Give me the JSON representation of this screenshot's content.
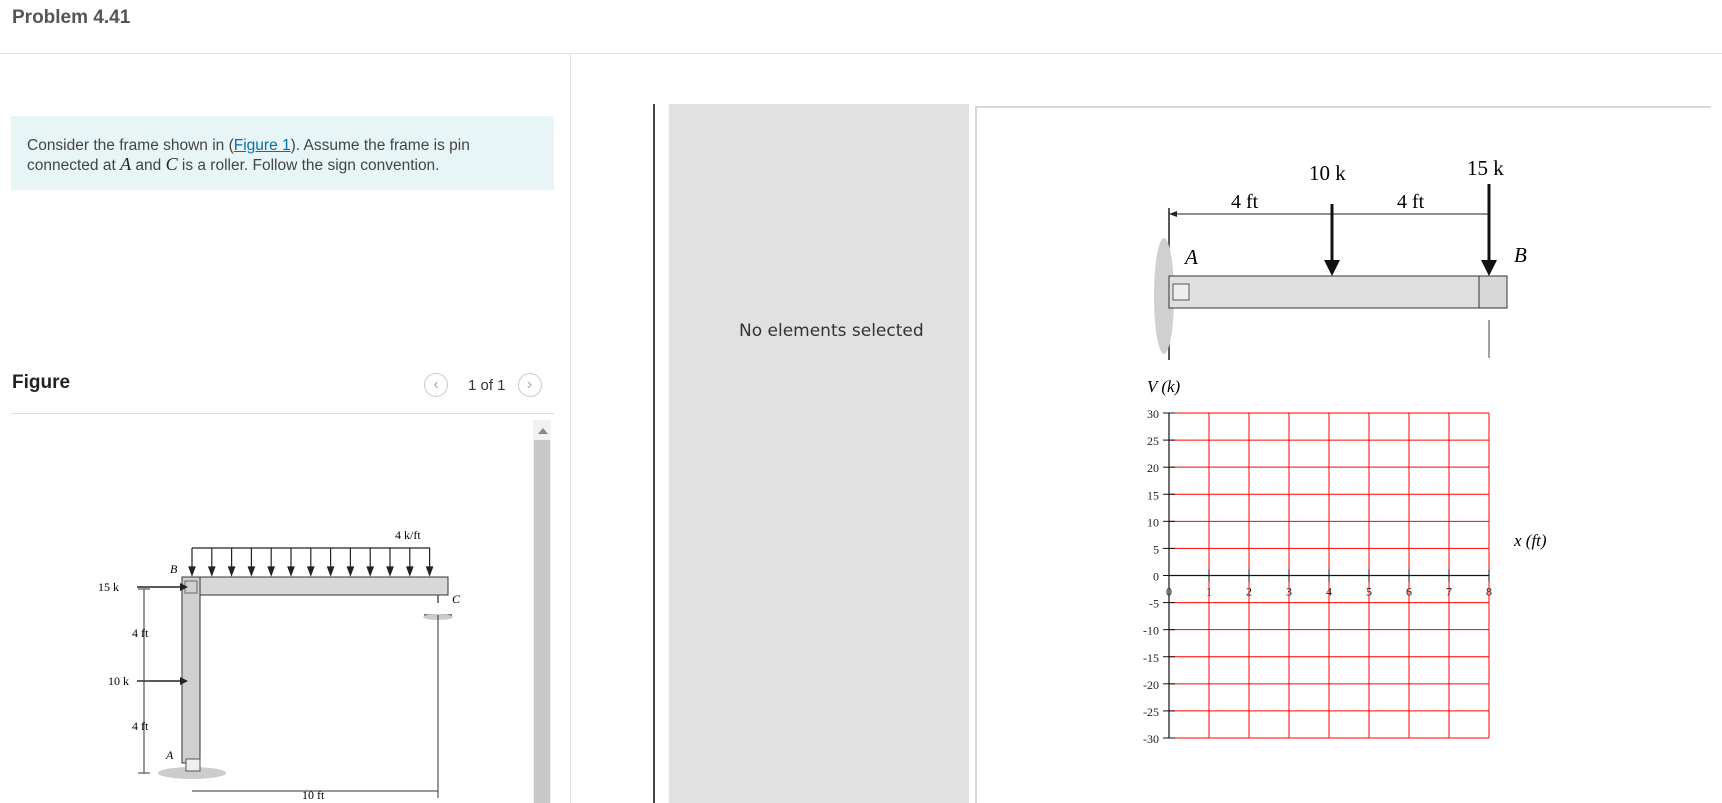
{
  "header": {
    "title": "Problem 4.41"
  },
  "prompt": {
    "text_1": "Consider the frame shown in (",
    "figure_link": "Figure 1",
    "text_2": "). Assume the frame is pin",
    "text_3": "connected at ",
    "point_a": "A",
    "text_4": " and ",
    "point_c": "C",
    "text_5": " is a roller. Follow the sign convention."
  },
  "figure": {
    "title": "Figure",
    "pager": "1 of 1",
    "labels": {
      "load_15k": "15 k",
      "load_10k": "10 k",
      "dist_load": "4 k/ft",
      "dim_4ft_top": "4 ft",
      "dim_4ft_bottom": "4 ft",
      "dim_10ft": "10 ft",
      "point_a": "A",
      "point_b": "B",
      "point_c": "C"
    }
  },
  "inspector": {
    "empty_text": "No elements selected"
  },
  "diagram": {
    "load_left": "10 k",
    "load_right": "15 k",
    "dim_left": "4 ft",
    "dim_right": "4 ft",
    "point_a": "A",
    "point_b": "B"
  },
  "chart_data": {
    "type": "line",
    "title": "",
    "ylabel": "V (k)",
    "xlabel": "x (ft)",
    "xlim": [
      0,
      8
    ],
    "ylim": [
      -30,
      30
    ],
    "x_ticks": [
      0,
      1,
      2,
      3,
      4,
      5,
      6,
      7,
      8
    ],
    "y_ticks": [
      30,
      25,
      20,
      15,
      10,
      5,
      0,
      -5,
      -10,
      -15,
      -20,
      -25,
      -30
    ],
    "grid": true,
    "grid_color": "#ff0000",
    "series": []
  }
}
